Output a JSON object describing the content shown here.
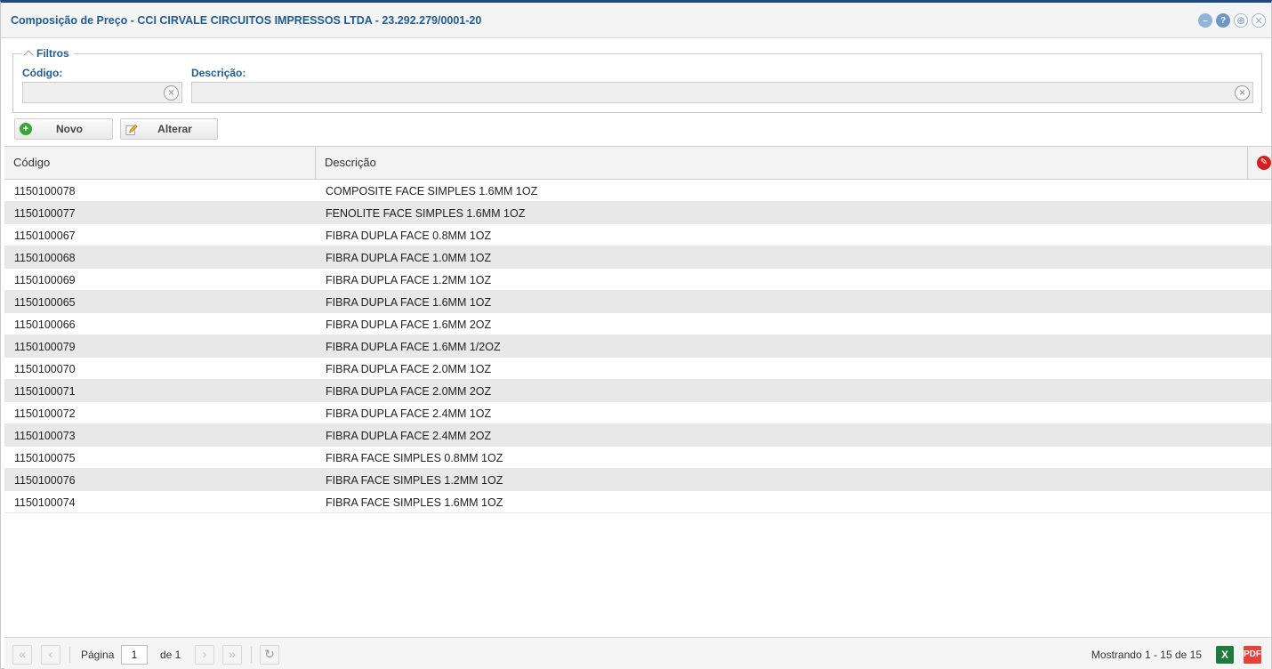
{
  "window": {
    "title": "Composição de Preço - CCI CIRVALE CIRCUITOS IMPRESSOS LTDA - 23.292.279/0001-20"
  },
  "filters": {
    "legend": "Filtros",
    "codigo_label": "Código:",
    "codigo_value": "",
    "descricao_label": "Descrição:",
    "descricao_value": ""
  },
  "toolbar": {
    "novo_label": "Novo",
    "alterar_label": "Alterar"
  },
  "grid": {
    "columns": [
      "Código",
      "Descrição"
    ],
    "rows": [
      {
        "codigo": "1150100078",
        "descricao": "COMPOSITE FACE SIMPLES 1.6MM 1OZ"
      },
      {
        "codigo": "1150100077",
        "descricao": "FENOLITE FACE SIMPLES 1.6MM 1OZ"
      },
      {
        "codigo": "1150100067",
        "descricao": "FIBRA DUPLA FACE 0.8MM 1OZ"
      },
      {
        "codigo": "1150100068",
        "descricao": "FIBRA DUPLA FACE 1.0MM 1OZ"
      },
      {
        "codigo": "1150100069",
        "descricao": "FIBRA DUPLA FACE 1.2MM 1OZ"
      },
      {
        "codigo": "1150100065",
        "descricao": "FIBRA DUPLA FACE 1.6MM 1OZ"
      },
      {
        "codigo": "1150100066",
        "descricao": "FIBRA DUPLA FACE 1.6MM 2OZ"
      },
      {
        "codigo": "1150100079",
        "descricao": "FIBRA DUPLA FACE 1.6MM 1/2OZ"
      },
      {
        "codigo": "1150100070",
        "descricao": "FIBRA DUPLA FACE 2.0MM 1OZ"
      },
      {
        "codigo": "1150100071",
        "descricao": "FIBRA DUPLA FACE 2.0MM 2OZ"
      },
      {
        "codigo": "1150100072",
        "descricao": "FIBRA DUPLA FACE 2.4MM 1OZ"
      },
      {
        "codigo": "1150100073",
        "descricao": "FIBRA DUPLA FACE 2.4MM 2OZ"
      },
      {
        "codigo": "1150100075",
        "descricao": "FIBRA FACE SIMPLES 0.8MM 1OZ"
      },
      {
        "codigo": "1150100076",
        "descricao": "FIBRA FACE SIMPLES 1.2MM 1OZ"
      },
      {
        "codigo": "1150100074",
        "descricao": "FIBRA FACE SIMPLES 1.6MM 1OZ"
      }
    ]
  },
  "pager": {
    "page_label": "Página",
    "page_value": "1",
    "of_label": "de 1",
    "info": "Mostrando 1 - 15 de 15"
  },
  "icons": {
    "title_tools": [
      "minimize-icon",
      "help-icon",
      "maximize-icon",
      "close-icon"
    ],
    "novo": "add-icon",
    "alterar": "edit-icon",
    "export": [
      "excel-icon",
      "pdf-icon"
    ]
  },
  "colors": {
    "accent": "#1f5b95",
    "top_border": "#1e4a7e",
    "row_alt": "#e8e8e8"
  }
}
